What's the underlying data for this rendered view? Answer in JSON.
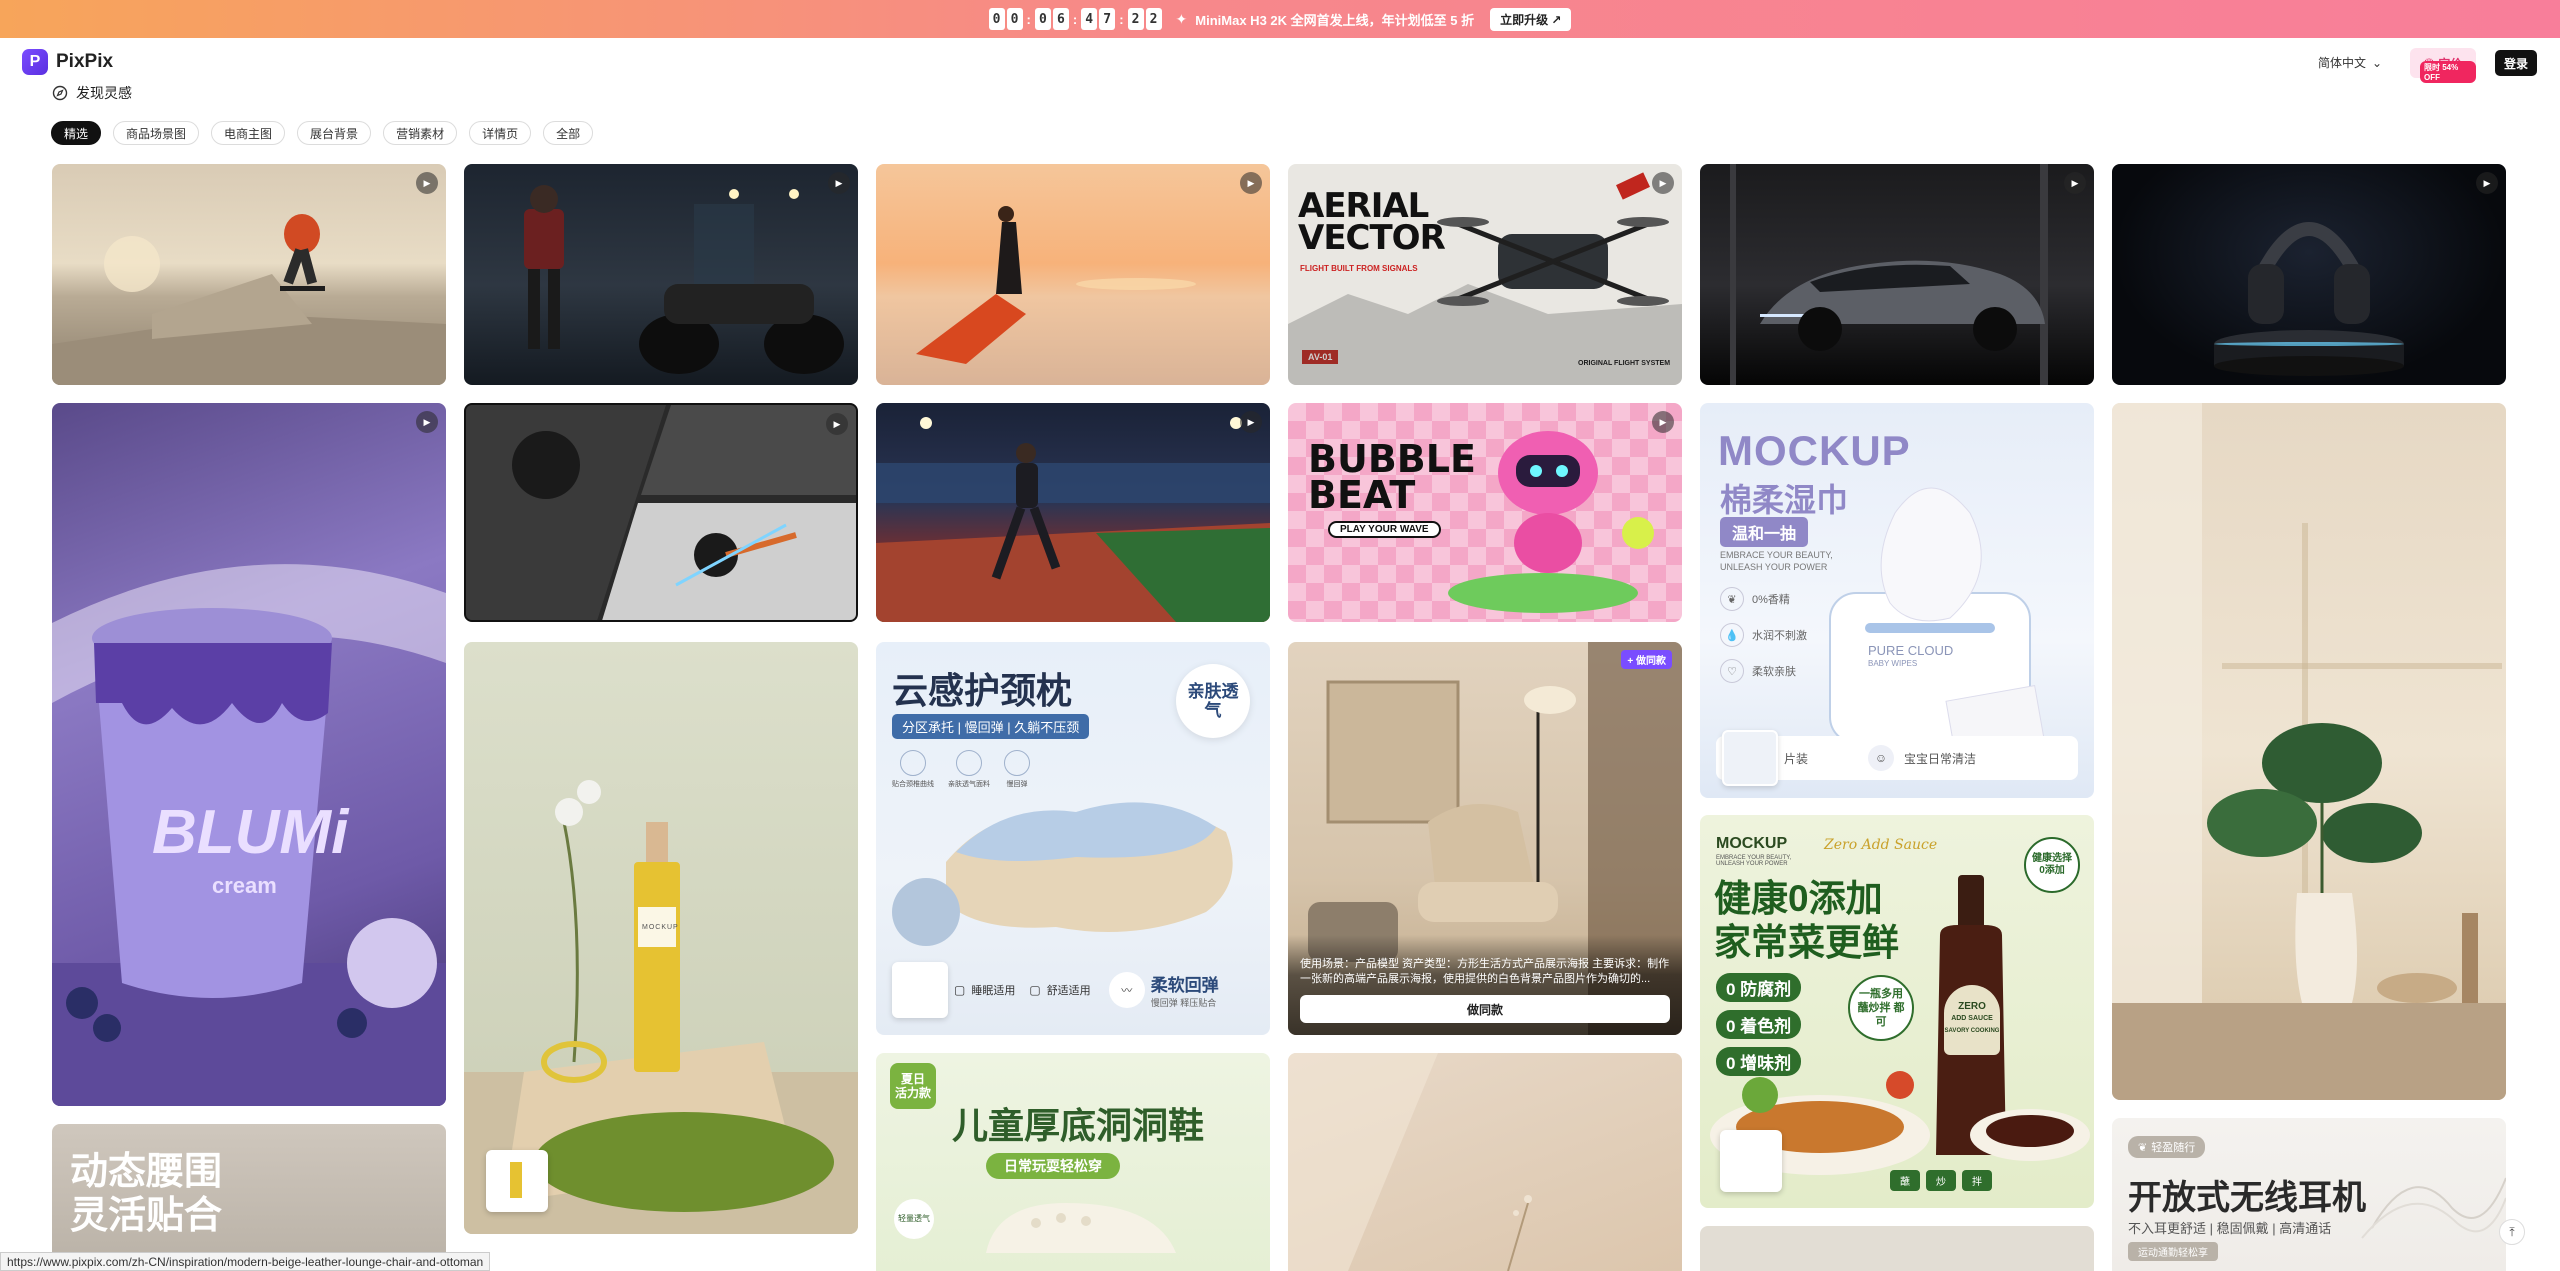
{
  "promo": {
    "countdown": [
      "0",
      "0",
      "0",
      "6",
      "4",
      "7",
      "2",
      "2"
    ],
    "text": "MiniMax H3 2K 全网首发上线，年计划低至 5 折",
    "upgrade_label": "立即升级 ↗"
  },
  "header": {
    "logo_letter": "P",
    "brand": "PixPix",
    "language": "简体中文",
    "pricing_label": "定价",
    "pricing_badge": "限时 54% OFF",
    "login_label": "登录"
  },
  "section_title": "发现灵感",
  "tabs": [
    {
      "label": "精选",
      "active": true
    },
    {
      "label": "商品场景图",
      "active": false
    },
    {
      "label": "电商主图",
      "active": false
    },
    {
      "label": "展台背景",
      "active": false
    },
    {
      "label": "营销素材",
      "active": false
    },
    {
      "label": "详情页",
      "active": false
    },
    {
      "label": "全部",
      "active": false
    }
  ],
  "cards": {
    "drone": {
      "title_line1": "AERIAL",
      "title_line2": "VECTOR",
      "tagline": "FLIGHT BUILT FROM SIGNALS",
      "tag": "AV-01",
      "footer": "ORIGINAL FLIGHT SYSTEM"
    },
    "bubble": {
      "title_line1": "BUBBLE",
      "title_line2": "BEAT",
      "tagline": "PLAY YOUR WAVE"
    },
    "wipes": {
      "brand": "MOCKUP",
      "title": "棉柔湿巾",
      "badge": "温和一抽",
      "sub1": "EMBRACE YOUR BEAUTY,",
      "sub2": "UNLEASH YOUR POWER",
      "f1": "0%香精",
      "f2": "水润不刺激",
      "f3": "柔软亲肤",
      "pack_brand": "PURE CLOUD",
      "pack_sub": "BABY WIPES",
      "b1": "片装",
      "b2": "宝宝日常清洁"
    },
    "icecream": {
      "brand": "BLUMi",
      "sub": "cream"
    },
    "pillow": {
      "title": "云感护颈枕",
      "sub": "分区承托 | 慢回弹 | 久躺不压颈",
      "badge": "亲肤透气",
      "f1": "贴合颈椎曲线",
      "f2": "亲肤透气面料",
      "f3": "慢回弹",
      "b1": "睡眠适用",
      "b2": "舒适适用",
      "b3_title": "柔软回弹",
      "b3_sub": "慢回弹 释压贴合"
    },
    "chair": {
      "badge": "+ 做同款",
      "prompt": "使用场景：产品模型 资产类型：方形生活方式产品展示海报 主要诉求：制作一张新的高端产品展示海报，使用提供的白色背景产品图片作为确切的...",
      "action": "做同款"
    },
    "sauce": {
      "brand": "MOCKUP",
      "sub": "EMBRACE YOUR BEAUTY, UNLEASH YOUR POWER",
      "script": "Zero Add Sauce",
      "title1": "健康0添加",
      "title2": "家常菜更鲜",
      "badge": "健康选择 0添加",
      "i1": "0 防腐剂",
      "i2": "0 着色剂",
      "i3": "0 增味剂",
      "circle": "一瓶多用 蘸炒拌 都可",
      "bottle1": "ZERO",
      "bottle2": "ADD SAUCE",
      "bottle3": "SAVORY COOKING",
      "c1": "蘸",
      "c2": "炒",
      "c3": "拌"
    },
    "waist": {
      "title1": "动态腰围",
      "title2": "灵活贴合"
    },
    "clogs": {
      "tag": "夏日 活力款",
      "title": "儿童厚底洞洞鞋",
      "sub": "日常玩耍轻松穿",
      "badge": "轻量透气"
    },
    "perfume": {
      "label": "MOCKUP"
    },
    "earphones": {
      "tag": "轻盈随行",
      "title": "开放式无线耳机",
      "sub": "不入耳更舒适 | 稳固佩戴 | 高清通话",
      "badge": "运动通勤轻松享"
    }
  },
  "status_url": "https://www.pixpix.com/zh-CN/inspiration/modern-beige-leather-lounge-chair-and-ottoman"
}
